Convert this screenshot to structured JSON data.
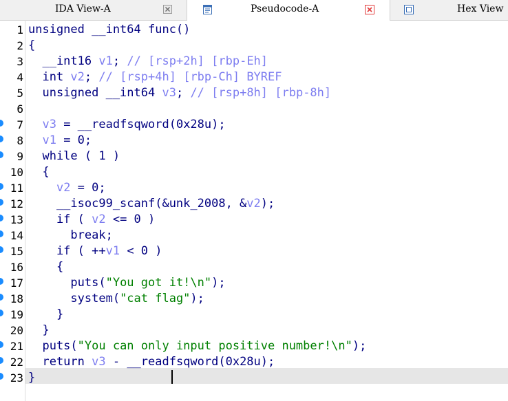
{
  "tabs": [
    {
      "label": "IDA View-A",
      "icon": "ida-view-icon",
      "closable": true
    },
    {
      "label": "Pseudocode-A",
      "icon": "pseudocode-icon",
      "closable": true,
      "active": true,
      "close_color": "#e23b3b"
    },
    {
      "label": "Hex View",
      "icon": "hex-view-icon",
      "closable": false
    }
  ],
  "code": {
    "line_numbers": [
      "1",
      "2",
      "3",
      "4",
      "5",
      "6",
      "7",
      "8",
      "9",
      "10",
      "11",
      "12",
      "13",
      "14",
      "15",
      "16",
      "17",
      "18",
      "19",
      "20",
      "21",
      "22",
      "23"
    ],
    "lines": [
      "unsigned __int64 func()",
      "{",
      "  __int16 v1; // [rsp+2h] [rbp-Eh]",
      "  int v2; // [rsp+4h] [rbp-Ch] BYREF",
      "  unsigned __int64 v3; // [rsp+8h] [rbp-8h]",
      "",
      "  v3 = __readfsqword(0x28u);",
      "  v1 = 0;",
      "  while ( 1 )",
      "  {",
      "    v2 = 0;",
      "    __isoc99_scanf(&unk_2008, &v2);",
      "    if ( v2 <= 0 )",
      "      break;",
      "    if ( ++v1 < 0 )",
      "    {",
      "      puts(\"You got it!\\n\");",
      "      system(\"cat flag\");",
      "    }",
      "  }",
      "  puts(\"You can only input positive number!\\n\");",
      "  return v3 - __readfsqword(0x28u);",
      "}"
    ],
    "breakpoint_markers_on_lines": [
      7,
      8,
      9,
      11,
      12,
      13,
      14,
      15,
      17,
      18,
      19,
      21,
      22,
      23
    ],
    "highlighted_line": 23
  },
  "colors": {
    "keyword": "#000080",
    "comment": "#7d7df0",
    "variable": "#7d7df0",
    "string": "#008000",
    "marker": "#1a8cff",
    "highlight": "#e6e6e6"
  }
}
